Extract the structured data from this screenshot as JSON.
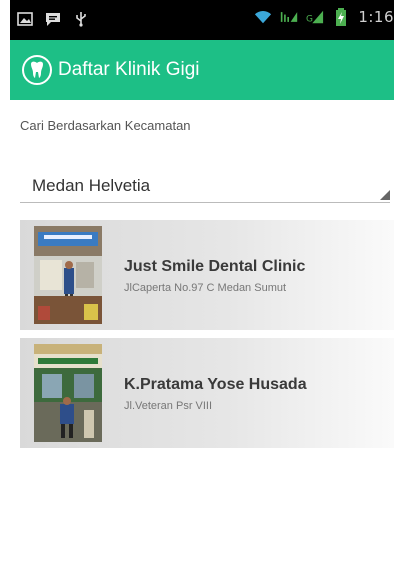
{
  "status_bar": {
    "time": "1:16",
    "left_icons": [
      "image-icon",
      "chat-icon",
      "usb-icon"
    ],
    "right_icons": [
      "wifi-icon",
      "data-arrows-icon",
      "signal-icon",
      "battery-icon"
    ]
  },
  "app_bar": {
    "title": "Daftar Klinik Gigi",
    "logo_icon": "tooth-icon",
    "color": "#1dbf86"
  },
  "filter": {
    "label": "Cari Berdasarkan Kecamatan",
    "selected": "Medan Helvetia"
  },
  "clinics": [
    {
      "name": "Just Smile Dental Clinic",
      "address": "JlCaperta No.97 C Medan Sumut"
    },
    {
      "name": "K.Pratama Yose Husada",
      "address": "Jl.Veteran Psr VIII"
    }
  ]
}
